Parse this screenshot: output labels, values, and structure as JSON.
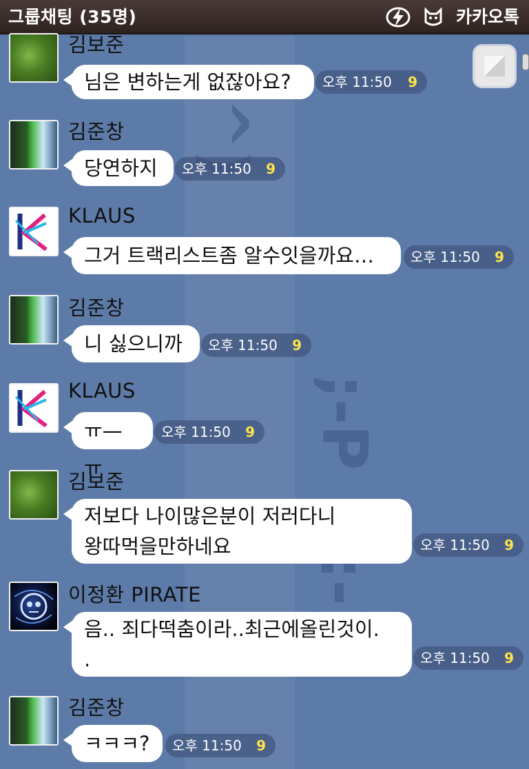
{
  "header": {
    "title": "그룹채팅 (35명)",
    "app_name": "카카오톡"
  },
  "messages": [
    {
      "sender": "김보준",
      "avatar": "green-blur-photo",
      "text": "님은 변하는게 없잖아요?",
      "time": "오후 11:50",
      "unread": "9"
    },
    {
      "sender": "김준창",
      "avatar": "green-phone-photo",
      "text": "당연하지",
      "time": "오후 11:50",
      "unread": "9"
    },
    {
      "sender": "KLAUS",
      "avatar": "k-logo",
      "text": "그거 트랙리스트좀 알수잇을까요…",
      "time": "오후 11:50",
      "unread": "9"
    },
    {
      "sender": "김준창",
      "avatar": "green-phone-photo",
      "text": "니 싫으니까",
      "time": "오후 11:50",
      "unread": "9"
    },
    {
      "sender": "KLAUS",
      "avatar": "k-logo",
      "text": "ㅠ—ㅠ",
      "time": "오후 11:50",
      "unread": "9"
    },
    {
      "sender": "김보준",
      "avatar": "green-blur-photo",
      "text": "저보다 나이많은분이 저러다니\n왕따먹을만하네요",
      "time": "오후 11:50",
      "unread": "9"
    },
    {
      "sender": "이정환 PIRATE",
      "avatar": "pirate-skull-logo",
      "text": "음.. 죄다떡춤이라..최근에올린것이.\n.",
      "time": "오후 11:50",
      "unread": "9"
    },
    {
      "sender": "김준창",
      "avatar": "green-phone-photo",
      "text": "ㅋㅋㅋ?",
      "time": "오후 11:50",
      "unread": "9"
    }
  ],
  "icons": {
    "bolt": "lightning-icon",
    "app": "kakao-character-icon",
    "thumb": "image-thumbnail-icon"
  },
  "colors": {
    "background": "#5c7aa8",
    "bubble": "#ffffff",
    "unread": "#ffe24a",
    "header": "#3a2d29"
  }
}
